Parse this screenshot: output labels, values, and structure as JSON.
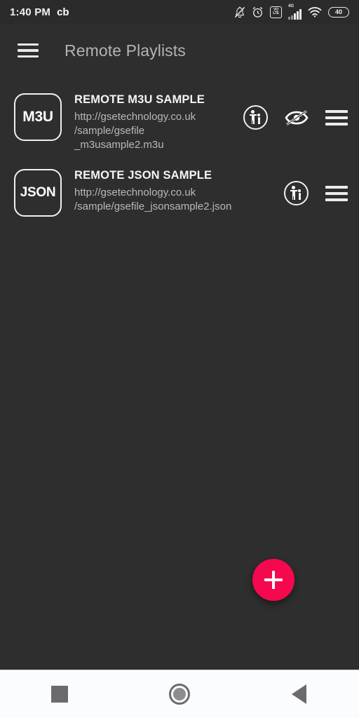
{
  "status_bar": {
    "time": "1:40 PM",
    "carrier_label": "cb",
    "icons": [
      "bell-off-icon",
      "alarm-clock-icon",
      "volte-icon",
      "signal-4g-icon",
      "wifi-icon",
      "battery-icon"
    ],
    "volte_top": "VO",
    "volte_bottom": "LTE",
    "network_type": "4G",
    "battery_level": "40"
  },
  "app_bar": {
    "menu_icon": "hamburger-menu-icon",
    "title": "Remote Playlists"
  },
  "playlists": [
    {
      "badge": "M3U",
      "title": "REMOTE M3U SAMPLE",
      "url_lines": [
        "http://gsetechnology.co.uk",
        "/sample/gsefile",
        "_m3usample2.m3u"
      ],
      "actions": [
        "parental-control-icon",
        "eye-off-icon",
        "drag-handle-icon"
      ]
    },
    {
      "badge": "JSON",
      "title": "REMOTE JSON SAMPLE",
      "url_lines": [
        "http://gsetechnology.co.uk",
        "/sample/gsefile_jsonsample2.json"
      ],
      "actions": [
        "parental-control-icon",
        "drag-handle-icon"
      ]
    }
  ],
  "fab": {
    "icon": "plus-icon",
    "color": "#f5084e"
  },
  "nav_bar": {
    "recents_icon": "square-icon",
    "home_icon": "circle-icon",
    "back_icon": "triangle-left-icon"
  },
  "colors": {
    "background": "#2e2e2e",
    "status_bar": "#2b2b2b",
    "title_text": "#b3b3b3",
    "primary_text": "#f5f5f5",
    "secondary_text": "#b9b9b9",
    "accent": "#f5084e",
    "nav_bar_bg": "#fbfcfd"
  }
}
